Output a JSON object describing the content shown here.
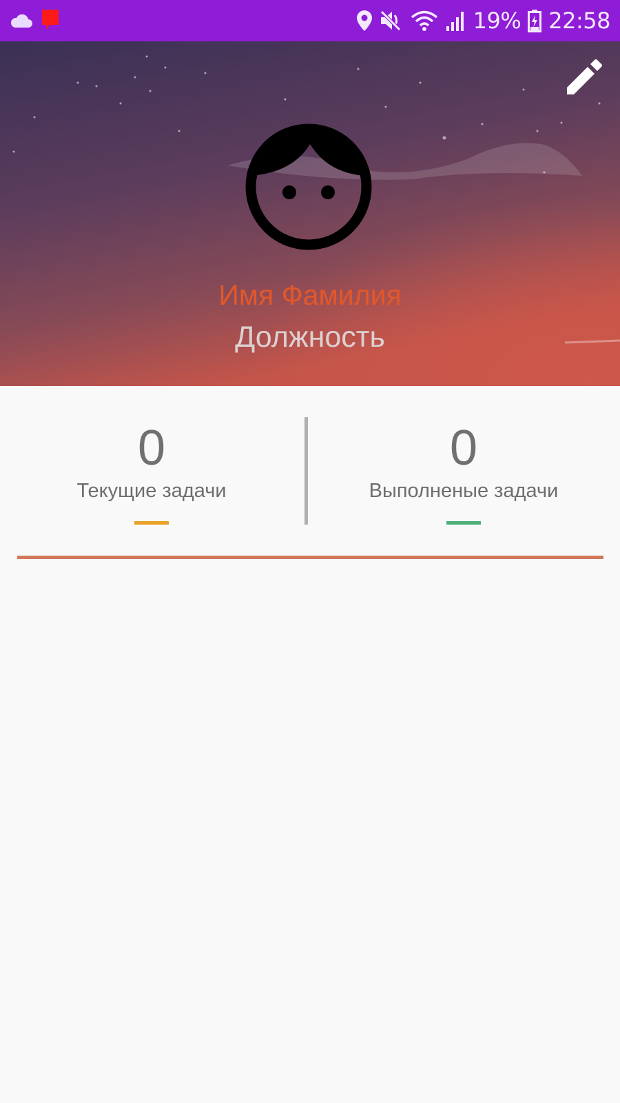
{
  "status_bar": {
    "background": "#8f1cd6",
    "icons": [
      "cloud-icon",
      "notification-flag-icon",
      "location-icon",
      "mute-icon",
      "wifi-icon",
      "signal-icon",
      "battery-charging-icon"
    ],
    "battery": "19%",
    "time": "22:58"
  },
  "header": {
    "edit_icon": "pencil-icon",
    "avatar_icon": "face-icon",
    "name": "Имя Фамилия",
    "position": "Должность",
    "gradient_top": "#3a3056",
    "gradient_bottom": "#c4554a"
  },
  "stats": {
    "current": {
      "value": "0",
      "label": "Текущие задачи",
      "accent": "#e8a126"
    },
    "completed": {
      "value": "0",
      "label": "Выполненые задачи",
      "accent": "#4caf7a"
    }
  },
  "colors": {
    "section_line": "#d07a5a",
    "background": "#f9f9f9"
  }
}
